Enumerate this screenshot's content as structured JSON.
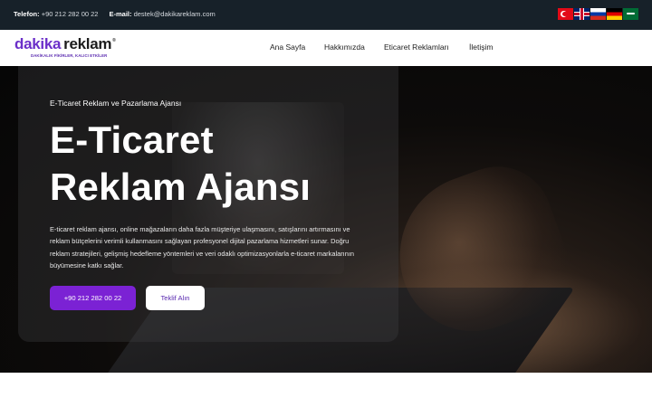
{
  "topbar": {
    "phone_label": "Telefon:",
    "phone_value": "+90 212 282 00 22",
    "email_label": "E-mail:",
    "email_value": "destek@dakikareklam.com",
    "languages": [
      "tr-flag-icon",
      "gb-flag-icon",
      "ru-flag-icon",
      "de-flag-icon",
      "sa-flag-icon"
    ]
  },
  "logo": {
    "part1": "dakika",
    "part2": "reklam",
    "registered": "®",
    "tagline": "DAKİKALIK FİKİRLER, KALICI ETKİLER"
  },
  "nav": {
    "items": [
      "Ana Sayfa",
      "Hakkımızda",
      "Eticaret Reklamları",
      "İletişim"
    ]
  },
  "hero": {
    "kicker": "E-Ticaret Reklam ve Pazarlama Ajansı",
    "title_line1": "E-Ticaret",
    "title_line2": "Reklam Ajansı",
    "description": "E-ticaret reklam ajansı, online mağazaların daha fazla müşteriye ulaşmasını, satışlarını artırmasını ve reklam bütçelerini verimli kullanmasını sağlayan profesyonel dijital pazarlama hizmetleri sunar. Doğru reklam stratejileri, gelişmiş hedefleme yöntemleri ve veri odaklı optimizasyonlarla e-ticaret markalarının büyümesine katkı sağlar.",
    "primary_button": "+90 212 282 00 22",
    "secondary_button": "Teklif Alın"
  },
  "colors": {
    "accent": "#7b22d4",
    "topbar_bg": "#172129"
  }
}
